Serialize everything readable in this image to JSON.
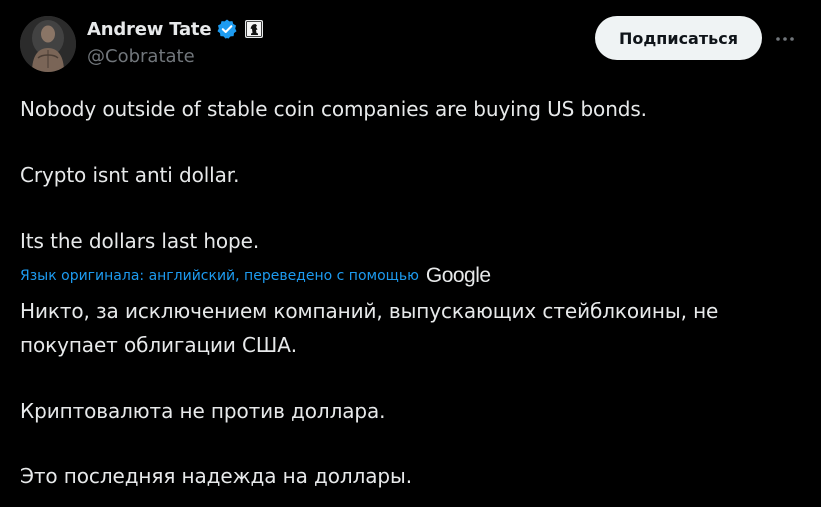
{
  "author": {
    "display_name": "Andrew Tate",
    "handle": "@Cobratate",
    "verified_icon": "verified-badge-icon",
    "affiliate_icon": "affiliate-badge-icon"
  },
  "actions": {
    "subscribe_label": "Подписаться",
    "more_icon": "more-horizontal-icon"
  },
  "tweet": {
    "original_lines": [
      "Nobody outside of stable coin companies are buying US bonds.",
      "Crypto isnt anti dollar.",
      "Its the dollars last hope."
    ],
    "translation_note": "Язык оригинала: английский, переведено с помощью",
    "translation_provider": "Google",
    "translated_lines": [
      "Никто, за исключением компаний, выпускающих стейблкоины, не",
      "покупает облигации США.",
      "Криптовалюта не против доллара.",
      "Это последняя надежда на доллары."
    ]
  },
  "colors": {
    "background": "#000000",
    "text": "#e7e9ea",
    "secondary_text": "#71767b",
    "link": "#1d9bf0",
    "button_bg": "#eff3f4",
    "verified": "#1d9bf0"
  }
}
